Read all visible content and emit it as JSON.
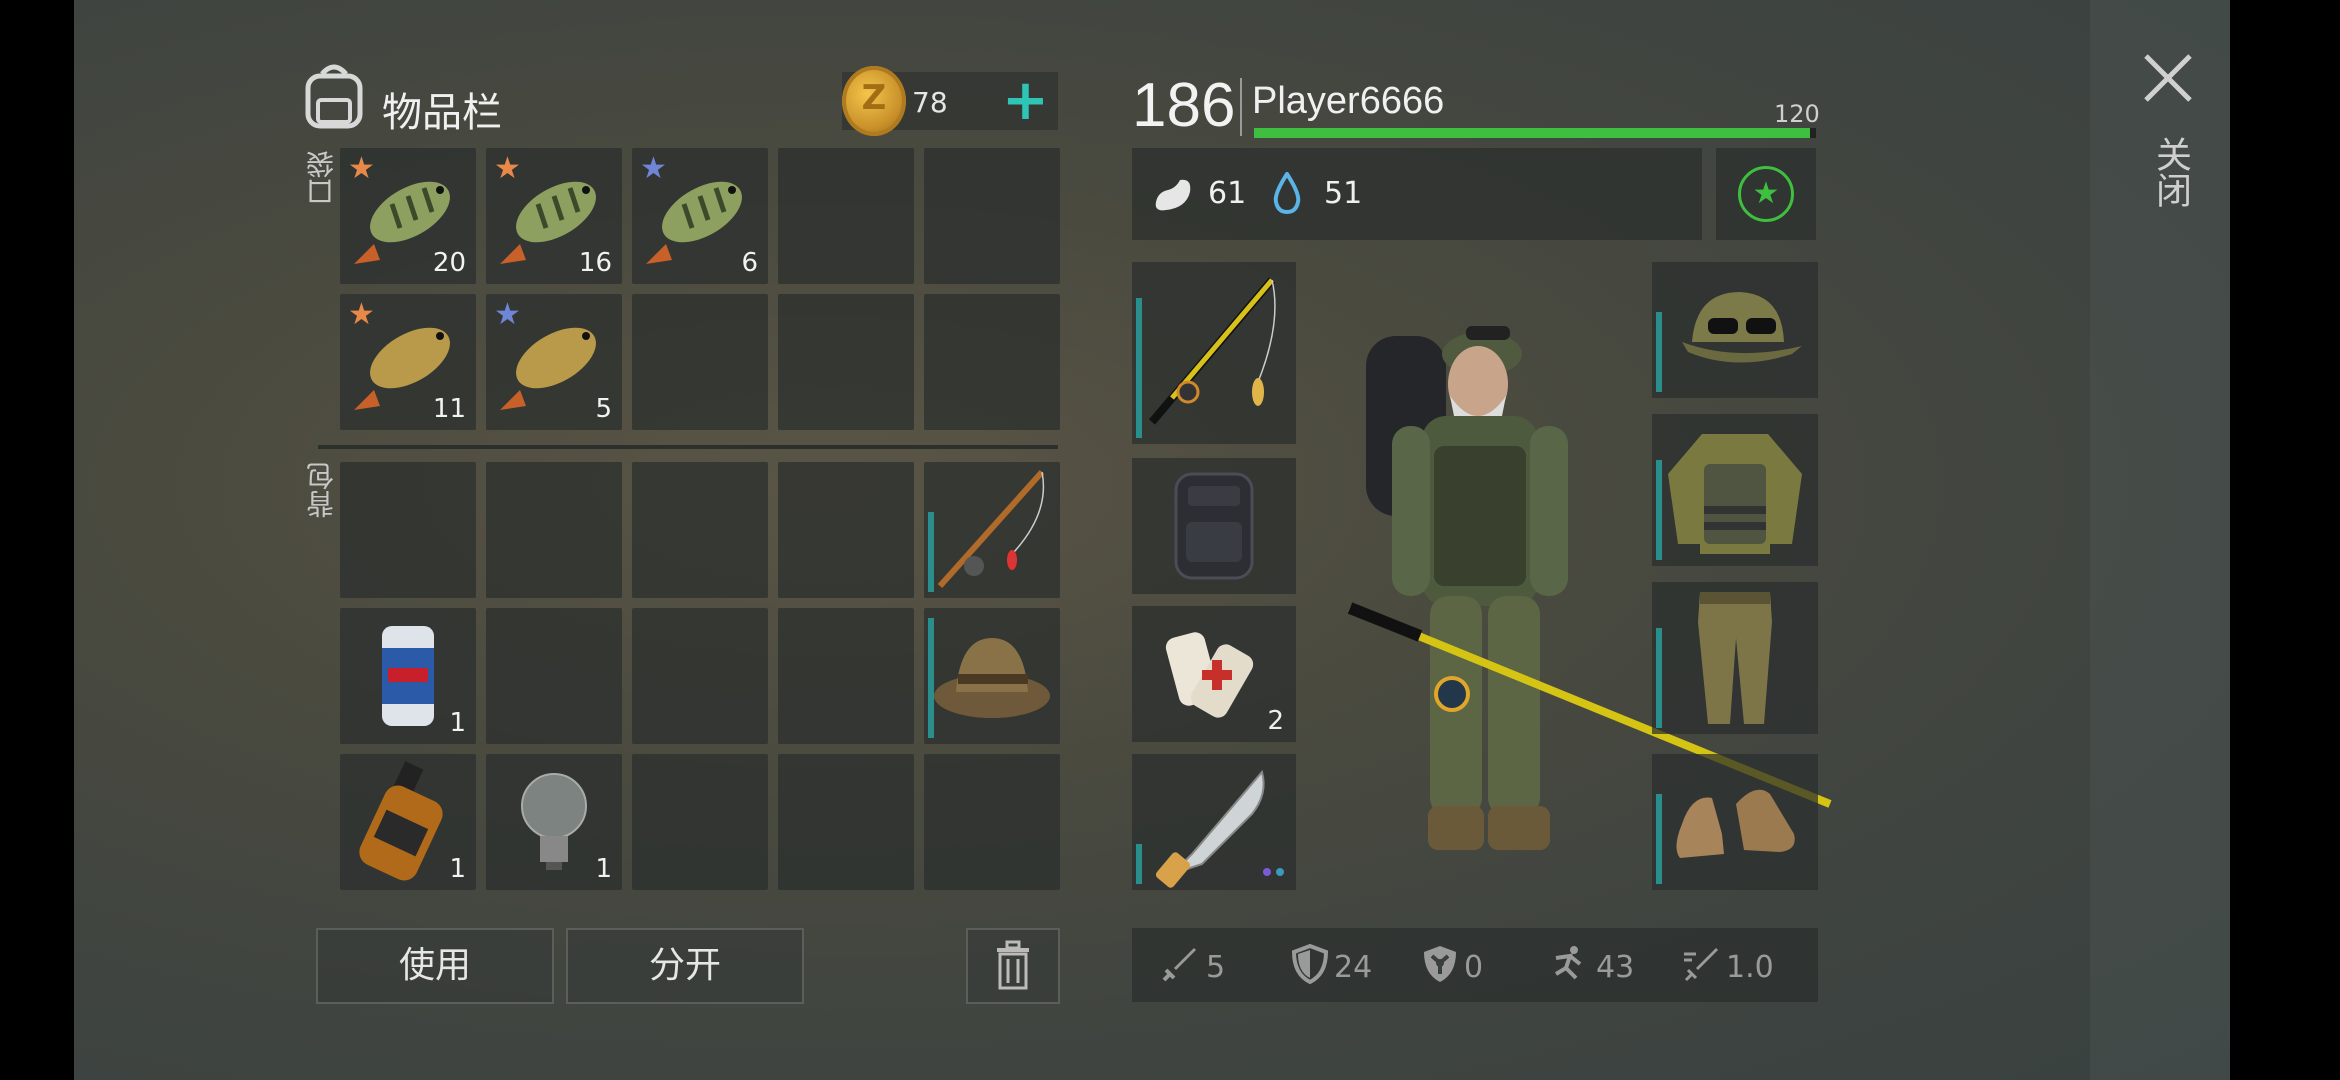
{
  "header": {
    "title": "物品栏",
    "coins": "78",
    "add_label": "+",
    "coin_symbol": "Z"
  },
  "sections": {
    "pocket_label": "口袋",
    "backpack_label": "背包"
  },
  "pocket_items": [
    {
      "name": "perch",
      "count": "20",
      "rarity": "orange"
    },
    {
      "name": "perch",
      "count": "16",
      "rarity": "orange"
    },
    {
      "name": "perch",
      "count": "6",
      "rarity": "blue"
    },
    {
      "name": "carp",
      "count": "11",
      "rarity": "orange"
    },
    {
      "name": "carp",
      "count": "5",
      "rarity": "blue"
    }
  ],
  "backpack_items": [
    {
      "name": "fishing-rod",
      "count": ""
    },
    {
      "name": "fishing-hat",
      "count": ""
    },
    {
      "name": "beer-can",
      "count": "1"
    },
    {
      "name": "whiskey-bottle",
      "count": "1"
    },
    {
      "name": "light-bulb",
      "count": "1"
    }
  ],
  "buttons": {
    "use": "使用",
    "split": "分开",
    "trash_icon": "trash-icon"
  },
  "player": {
    "level": "186",
    "name": "Player6666",
    "xp_label": "120",
    "xp_fraction": 0.99
  },
  "stats": {
    "hunger": "61",
    "thirst": "51"
  },
  "equipment": {
    "bandage_count": "2"
  },
  "bottom_stats": [
    {
      "icon": "sword-icon",
      "value": "5"
    },
    {
      "icon": "shield-icon",
      "value": "24"
    },
    {
      "icon": "radiation-shield-icon",
      "value": "0"
    },
    {
      "icon": "running-icon",
      "value": "43"
    },
    {
      "icon": "speed-icon",
      "value": "1.0"
    }
  ],
  "close": {
    "label": "关闭"
  },
  "colors": {
    "accent_teal": "#2ec4b6",
    "xp_green": "#3fbf3f",
    "star_orange": "#e8894a",
    "star_blue": "#6f86d6"
  }
}
